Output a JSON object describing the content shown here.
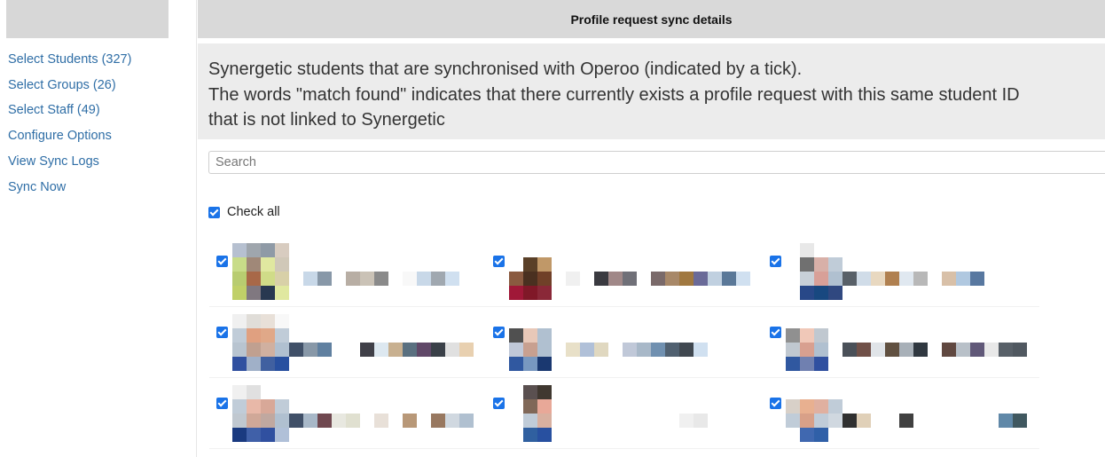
{
  "sidebar": {
    "items": [
      {
        "label": "Select Students (327)"
      },
      {
        "label": "Select Groups (26)"
      },
      {
        "label": "Select Staff (49)"
      },
      {
        "label": "Configure Options"
      },
      {
        "label": "View Sync Logs"
      },
      {
        "label": "Sync Now"
      }
    ]
  },
  "panel": {
    "title": "Profile request sync details",
    "info_lines": [
      "Synergetic students that are synchronised with Operoo (indicated by a tick).",
      "The words \"match found\" indicates that there currently exists a profile request with this same student ID",
      "that is not linked to Synergetic"
    ]
  },
  "search": {
    "placeholder": "Search",
    "value": ""
  },
  "check_all": {
    "label": "Check all",
    "checked": true
  },
  "students": [
    {
      "checked": true,
      "photo": [
        "#b6c0d0",
        "#9fa6ad",
        "#8f9aa6",
        "#d8ccc0",
        "#c8dc88",
        "#a08878",
        "#e0e8a0",
        "#d0c8b8",
        "#b8cc70",
        "#a86848",
        "#d0dc88",
        "#d8d0a8",
        "#c0d068",
        "#807880",
        "#283850",
        "#e0e8a0"
      ],
      "name_blocks": [
        "#ffffff",
        "#c8d8e8",
        "#8898a8",
        "#ffffff",
        "#b8aea4",
        "#cac2b6",
        "#8a8a8a",
        "#ffffff",
        "#f8f8f8",
        "#c8d8e8",
        "#a0a8b0",
        "#d0e0f0"
      ]
    },
    {
      "checked": true,
      "photo": [
        "#ffffff",
        "#ffffff",
        "#ffffff",
        "#ffffff",
        "#ffffff",
        "#5a4028",
        "#c09868",
        "#ffffff",
        "#8a5a40",
        "#4a3020",
        "#704028",
        "#ffffff",
        "#a01838",
        "#801828",
        "#8a2838",
        "#ffffff"
      ],
      "name_blocks": [
        "#f0f0f0",
        "#ffffff",
        "#3a3a40",
        "#a08888",
        "#707078",
        "#ffffff",
        "#7a6a6a",
        "#a88868",
        "#a07840",
        "#6a6a98",
        "#c0d0e0",
        "#5a7898",
        "#d0e0f0"
      ]
    },
    {
      "checked": true,
      "photo": [
        "#ffffff",
        "#e8e8e8",
        "#ffffff",
        "#ffffff",
        "#ffffff",
        "#707070",
        "#d8b0a8",
        "#c0ccd8",
        "#ffffff",
        "#c8d0d8",
        "#d8a098",
        "#b0c0d0",
        "#ffffff",
        "#284888",
        "#184880",
        "#304880"
      ],
      "name_blocks": [
        "#586068",
        "#d0dce8",
        "#e8d8c0",
        "#b08050",
        "#e0e8f0",
        "#b8b8b8",
        "#ffffff",
        "#d8c0a8",
        "#b0c8e0",
        "#5878a0"
      ]
    },
    {
      "checked": true,
      "photo": [
        "#f0f0f0",
        "#e0ddd8",
        "#e8e0d8",
        "#f8f8f8",
        "#c0ccd8",
        "#e0a080",
        "#e0a888",
        "#c0ccd8",
        "#b8c4d0",
        "#c0a090",
        "#d0b0a0",
        "#b0c0d0",
        "#3050a0",
        "#a0b0c8",
        "#4060a0",
        "#2850a0"
      ],
      "name_blocks": [
        "#405068",
        "#8898a8",
        "#6080a0",
        "#ffffff",
        "#ffffff",
        "#404048",
        "#dde8f0",
        "#c8b090",
        "#5a7080",
        "#604868",
        "#3a4048",
        "#e0e0e0",
        "#e8d0b0"
      ]
    },
    {
      "checked": true,
      "photo": [
        "#ffffff",
        "#ffffff",
        "#ffffff",
        "#ffffff",
        "#505050",
        "#e8c8b8",
        "#b0c0d0",
        "#ffffff",
        "#c0c8d8",
        "#c8a090",
        "#b0c0d0",
        "#ffffff",
        "#3058a0",
        "#7898c0",
        "#1a3870",
        "#ffffff"
      ],
      "name_blocks": [
        "#e8e0c8",
        "#b0c0d8",
        "#e0d8c0",
        "#ffffff",
        "#c0c8d8",
        "#a8b8c8",
        "#7090b0",
        "#506070",
        "#404850",
        "#d0e0f0"
      ]
    },
    {
      "checked": true,
      "photo": [
        "#ffffff",
        "#ffffff",
        "#ffffff",
        "#ffffff",
        "#909090",
        "#f0c8b8",
        "#c0c8d0",
        "#ffffff",
        "#c0c8d0",
        "#d8a090",
        "#b0c0d0",
        "#ffffff",
        "#3058a0",
        "#7080b0",
        "#3050a0",
        "#ffffff"
      ],
      "name_blocks": [
        "#4a5058",
        "#705048",
        "#e0e4e8",
        "#605040",
        "#a8b0b8",
        "#303840",
        "#ffffff",
        "#604840",
        "#b8c0c8",
        "#605878",
        "#e8e8e8",
        "#586068",
        "#505860"
      ]
    },
    {
      "checked": true,
      "photo": [
        "#f0f0f0",
        "#e0e0e0",
        "#ffffff",
        "#ffffff",
        "#c0ccd8",
        "#e8b8a8",
        "#d8a898",
        "#c0ccd8",
        "#c0c8d0",
        "#d0a898",
        "#c0a8a0",
        "#b0c0d0",
        "#1a3a80",
        "#4060a8",
        "#3050a0",
        "#b0c0d8"
      ],
      "name_blocks": [
        "#405068",
        "#a8b8c8",
        "#704850",
        "#e8e8e0",
        "#e0e0d0",
        "#ffffff",
        "#e8e0d8",
        "#ffffff",
        "#b89878",
        "#ffffff",
        "#987860",
        "#d0d8e0",
        "#b0c0d0"
      ]
    },
    {
      "checked": true,
      "photo": [
        "#ffffff",
        "#5a5050",
        "#403830",
        "#ffffff",
        "#ffffff",
        "#806858",
        "#e8a898",
        "#ffffff",
        "#ffffff",
        "#c0ccd8",
        "#d8b0a0",
        "#ffffff",
        "#ffffff",
        "#3060a0",
        "#2850a0",
        "#ffffff"
      ],
      "name_blocks": [
        "#ffffff",
        "#ffffff",
        "#ffffff",
        "#ffffff",
        "#ffffff",
        "#ffffff",
        "#ffffff",
        "#ffffff",
        "#f0f0f0",
        "#e8e8e8",
        "#ffffff"
      ]
    },
    {
      "checked": true,
      "photo": [
        "#ffffff",
        "#ffffff",
        "#ffffff",
        "#ffffff",
        "#d8d0c8",
        "#e8b090",
        "#e0b0a0",
        "#c0ccd8",
        "#c0ccd8",
        "#d8a088",
        "#c0ccd8",
        "#d0d8e0",
        "#ffffff",
        "#4068b0",
        "#3060a8",
        "#ffffff"
      ],
      "name_blocks": [
        "#303030",
        "#e0d0b8",
        "#ffffff",
        "#ffffff",
        "#404040",
        "#ffffff",
        "#ffffff",
        "#ffffff",
        "#ffffff",
        "#ffffff",
        "#ffffff",
        "#6088a8",
        "#405860"
      ]
    }
  ]
}
